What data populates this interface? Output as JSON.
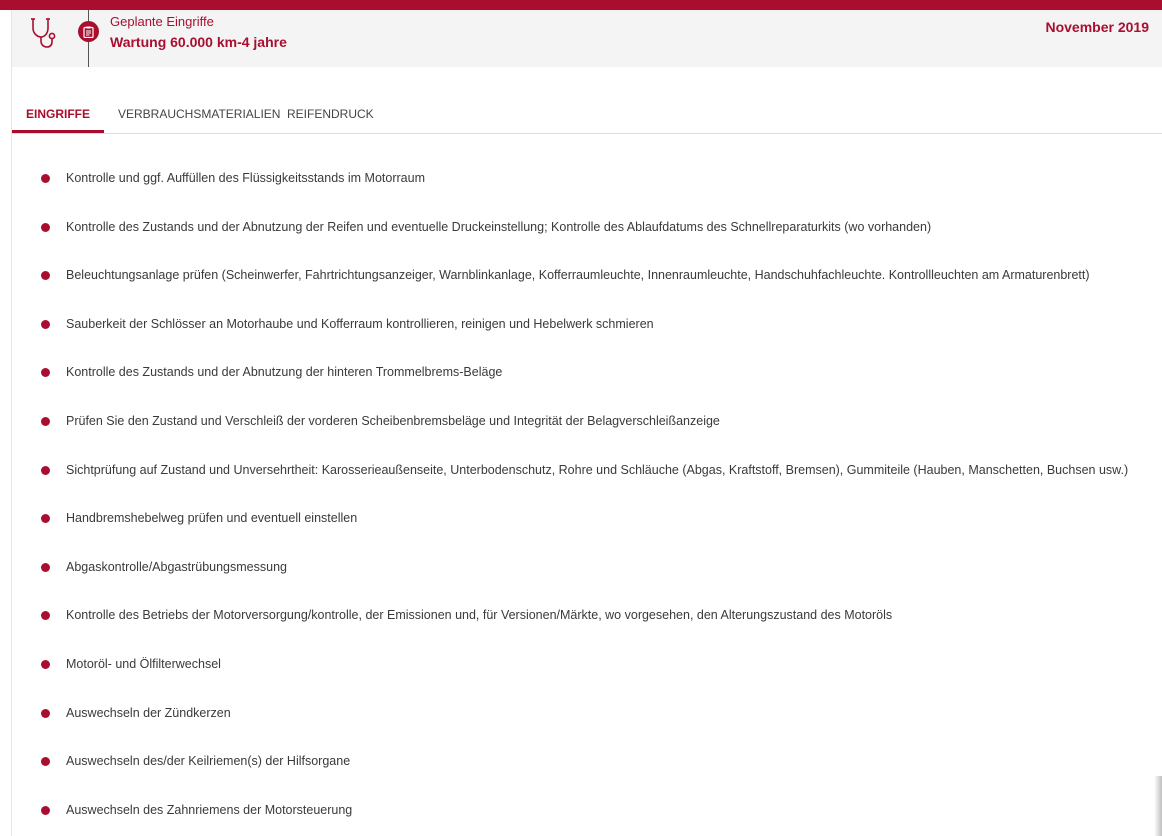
{
  "colors": {
    "accent": "#a90e2f",
    "header_bg": "#f4f4f4",
    "text": "#3a3a3a"
  },
  "header": {
    "icon": "stethoscope-icon",
    "timeline_icon": "clipboard-icon",
    "subtitle": "Geplante Eingriffe",
    "title": "Wartung 60.000 km-4 jahre",
    "date": "November 2019"
  },
  "tabs": [
    {
      "label": "EINGRIFFE",
      "active": true
    },
    {
      "label": "VERBRAUCHSMATERIALIEN",
      "active": false
    },
    {
      "label": "REIFENDRUCK",
      "active": false
    }
  ],
  "items": [
    "Kontrolle und ggf. Auffüllen des Flüssigkeitsstands im Motorraum",
    "Kontrolle des Zustands und der Abnutzung der Reifen und eventuelle Druckeinstellung; Kontrolle des Ablaufdatums des Schnellreparaturkits (wo vorhanden)",
    "Beleuchtungsanlage prüfen (Scheinwerfer, Fahrtrichtungsanzeiger, Warnblinkanlage, Kofferraumleuchte, Innenraumleuchte, Handschuhfachleuchte. Kontrollleuchten am Armaturenbrett)",
    "Sauberkeit der Schlösser an Motorhaube und Kofferraum kontrollieren, reinigen und Hebelwerk schmieren",
    "Kontrolle des Zustands und der Abnutzung der hinteren Trommelbrems-Beläge",
    "Prüfen Sie den Zustand und Verschleiß der vorderen Scheibenbremsbeläge und Integrität der Belagverschleißanzeige",
    "Sichtprüfung auf Zustand und Unversehrtheit: Karosserieaußenseite, Unterbodenschutz, Rohre und Schläuche (Abgas, Kraftstoff, Bremsen), Gummiteile (Hauben, Manschetten, Buchsen usw.)",
    "Handbremshebelweg prüfen und eventuell einstellen",
    "Abgaskontrolle/Abgastrübungsmessung",
    "Kontrolle des Betriebs der Motorversorgung/kontrolle, der Emissionen und, für Versionen/Märkte, wo vorgesehen, den Alterungszustand des Motoröls",
    "Motoröl- und Ölfilterwechsel",
    "Auswechseln der Zündkerzen",
    "Auswechseln des/der Keilriemen(s) der Hilfsorgane",
    "Auswechseln des Zahnriemens der Motorsteuerung"
  ]
}
